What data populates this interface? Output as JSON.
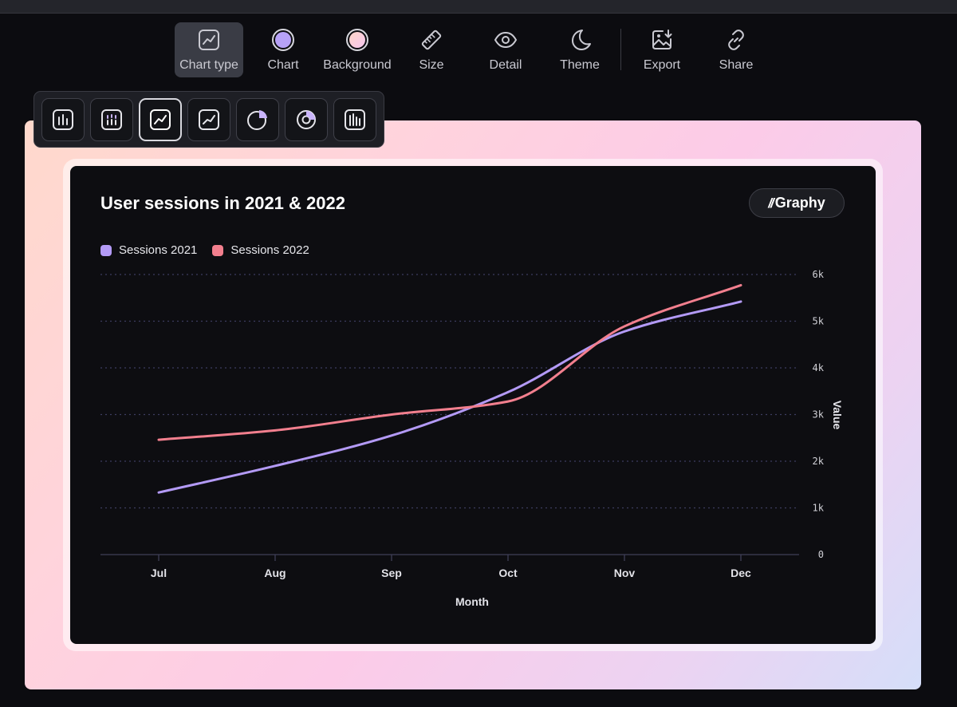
{
  "toolbar": {
    "items": [
      {
        "label": "Chart type",
        "icon": "line-chart-icon",
        "active": true
      },
      {
        "label": "Chart",
        "icon": "color-dot-icon",
        "color": "#b7a2f7"
      },
      {
        "label": "Background",
        "icon": "color-dot-icon",
        "color": "#fcd2e4"
      },
      {
        "label": "Size",
        "icon": "ruler-icon"
      },
      {
        "label": "Detail",
        "icon": "eye-icon"
      },
      {
        "label": "Theme",
        "icon": "moon-icon"
      },
      {
        "label": "Export",
        "icon": "export-image-icon"
      },
      {
        "label": "Share",
        "icon": "link-icon"
      }
    ]
  },
  "chart_types": [
    {
      "icon": "bar-chart-icon"
    },
    {
      "icon": "stacked-bar-chart-icon"
    },
    {
      "icon": "line-chart-icon",
      "active": true
    },
    {
      "icon": "area-line-chart-icon"
    },
    {
      "icon": "pie-chart-icon"
    },
    {
      "icon": "donut-chart-icon"
    },
    {
      "icon": "histogram-icon"
    }
  ],
  "brand": {
    "mark": "//",
    "name": "Graphy"
  },
  "colors": {
    "series_2021": "#b39af6",
    "series_2022": "#f27f8e",
    "card": "#0d0d11"
  },
  "chart_data": {
    "type": "line",
    "title": "User sessions in 2021 & 2022",
    "xlabel": "Month",
    "ylabel": "Value",
    "categories": [
      "Jul",
      "Aug",
      "Sep",
      "Oct",
      "Nov",
      "Dec"
    ],
    "ylim": [
      0,
      6000
    ],
    "yticks": [
      0,
      1000,
      2000,
      3000,
      4000,
      5000,
      6000
    ],
    "ytick_labels": [
      "0",
      "1k",
      "2k",
      "3k",
      "4k",
      "5k",
      "6k"
    ],
    "grid": true,
    "legend": "top-left",
    "series": [
      {
        "name": "Sessions 2021",
        "values": [
          1330,
          1900,
          2550,
          3480,
          4780,
          5420
        ]
      },
      {
        "name": "Sessions 2022",
        "values": [
          2460,
          2660,
          3000,
          3280,
          4890,
          5770
        ]
      }
    ]
  }
}
